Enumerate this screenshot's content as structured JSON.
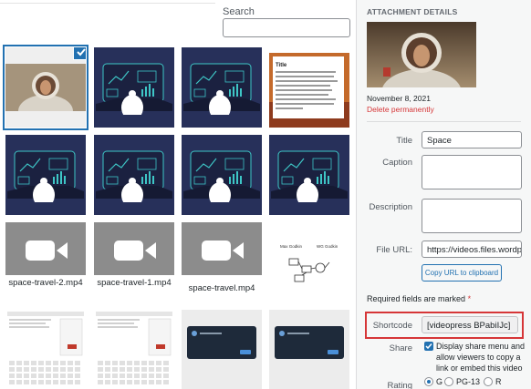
{
  "search": {
    "label": "Search",
    "value": ""
  },
  "grid": {
    "videos": [
      {
        "name": "space-travel-2.mp4"
      },
      {
        "name": "space-travel-1.mp4"
      },
      {
        "name": "space-travel.mp4"
      }
    ],
    "doc_tile": {
      "title": "Title"
    },
    "diagram_tile": {
      "label_left": "Max Godkin",
      "label_right": "WG Godkin"
    }
  },
  "details": {
    "heading": "ATTACHMENT DETAILS",
    "date": "November 8, 2021",
    "delete_link": "Delete permanently",
    "title_label": "Title",
    "title_value": "Space",
    "caption_label": "Caption",
    "caption_value": "",
    "description_label": "Description",
    "description_value": "",
    "file_url_label": "File URL:",
    "file_url_value": "https://videos.files.wordpr",
    "copy_url_button": "Copy URL to clipboard",
    "required_text": "Required fields are marked",
    "required_star": "*",
    "shortcode_label": "Shortcode",
    "shortcode_value": "[videopress BPabiIJc]",
    "share_label": "Share",
    "share_text": "Display share menu and allow viewers to copy a link or embed this video",
    "share_checked": true,
    "rating_label": "Rating",
    "rating_options": [
      "G",
      "PG-13",
      "R"
    ],
    "rating_selected": "G"
  },
  "colors": {
    "accent": "#2271b1",
    "danger": "#d63638",
    "illustration_bg": "#27305a",
    "video_placeholder": "#8c8c8c"
  }
}
